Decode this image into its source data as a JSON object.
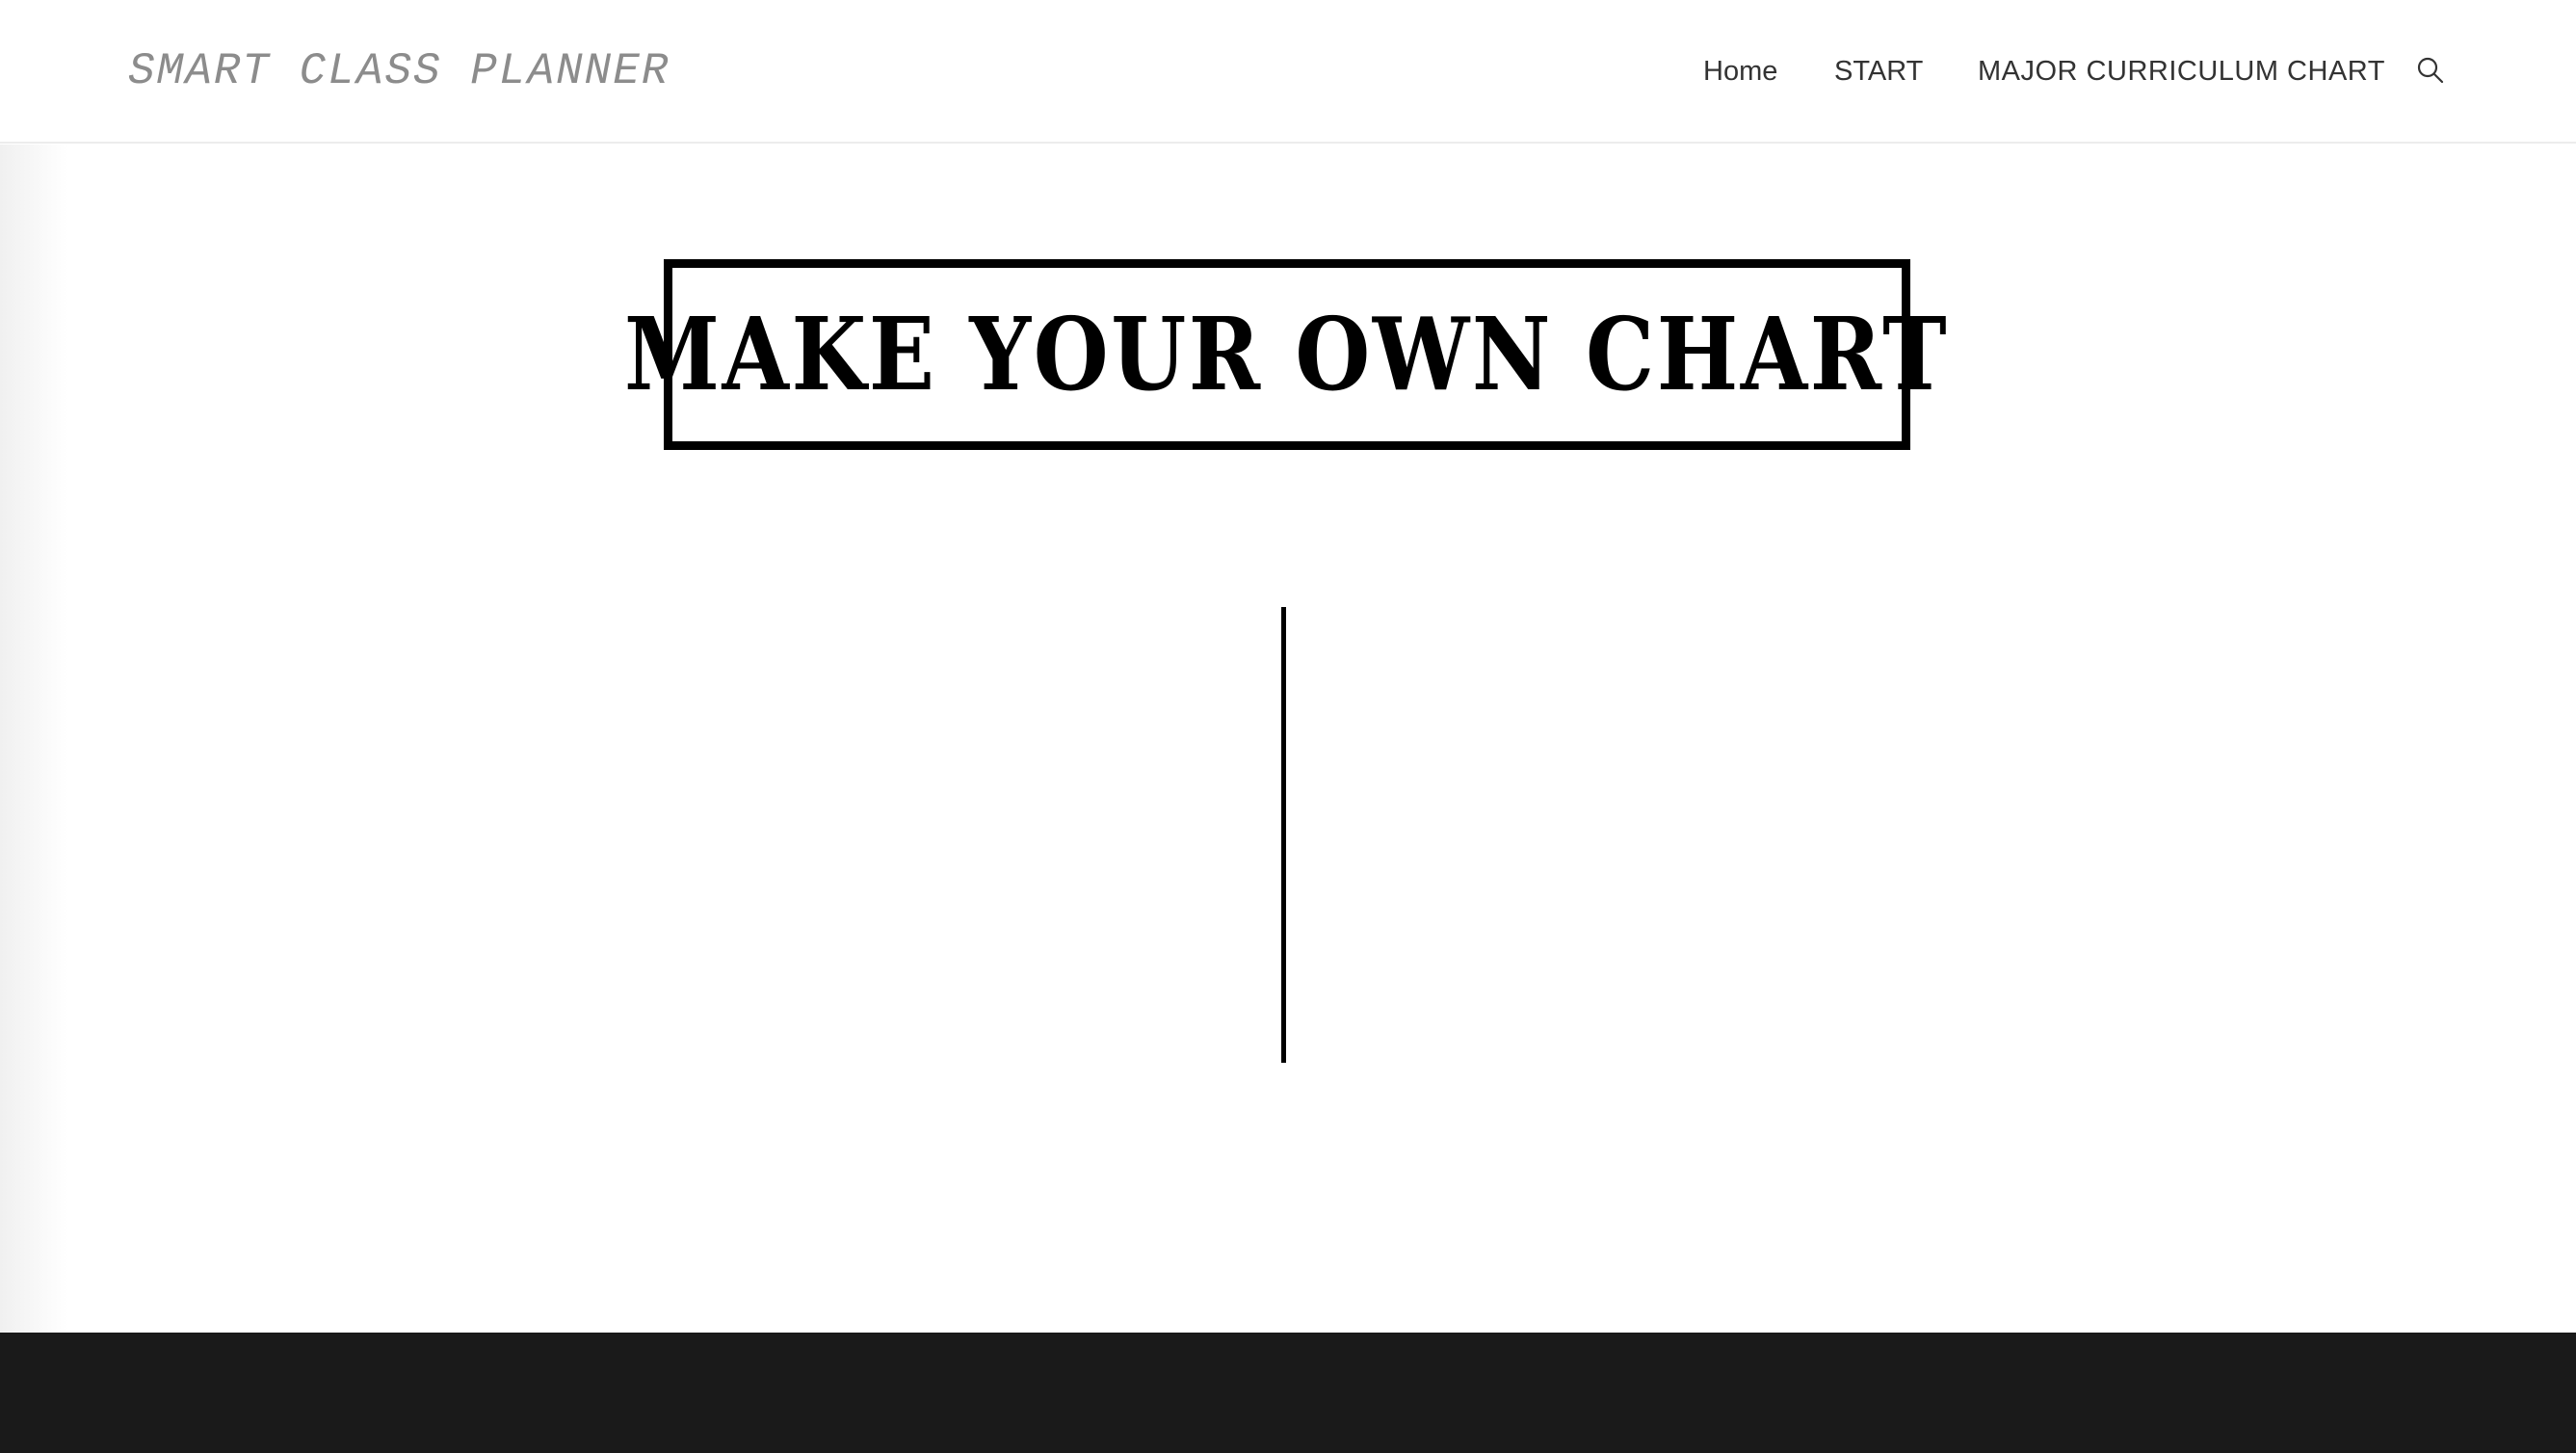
{
  "header": {
    "site_title": "SMART CLASS PLANNER",
    "nav": {
      "home": "Home",
      "start": "START",
      "major": "MAJOR CURRICULUM CHART"
    },
    "search_icon": "search-icon"
  },
  "main": {
    "title": "MAKE YOUR OWN CHART"
  },
  "colors": {
    "site_title": "#8c8c8c",
    "nav_text": "#333333",
    "title_border": "#000000",
    "footer_bg": "#1a1a1a"
  }
}
